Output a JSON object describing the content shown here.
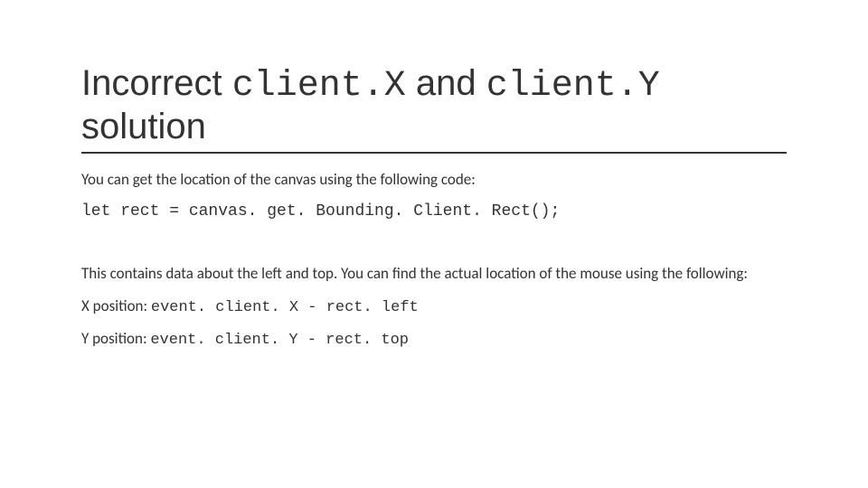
{
  "title": {
    "part1": "Incorrect ",
    "code1": "client.X",
    "part2": " and ",
    "code2": "client.Y",
    "part3": " solution"
  },
  "intro": "You can get the location of the canvas using the following code:",
  "code_get_rect": "let rect = canvas. get. Bounding. Client. Rect();",
  "explain": "This contains data about the left and top. You can find the actual location of the mouse using the following:",
  "x_pos": {
    "label": "X position: ",
    "code": "event. client. X - rect. left"
  },
  "y_pos": {
    "label": "Y position: ",
    "code": "event. client. Y - rect. top"
  }
}
